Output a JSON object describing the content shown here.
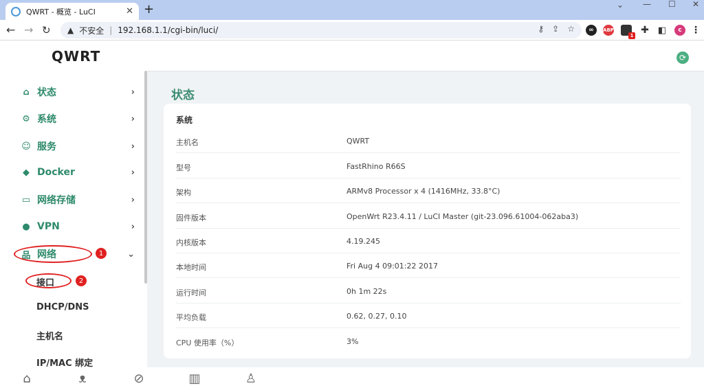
{
  "browser": {
    "tab_title": "QWRT - 概览 - LuCI",
    "tab_close": "✕",
    "new_tab": "+",
    "security_label": "不安全",
    "url": "192.168.1.1/cgi-bin/luci/",
    "ext_badge": "1",
    "profile_initial": "c"
  },
  "app": {
    "brand": "QWRT"
  },
  "sidebar": {
    "items": [
      {
        "label": "状态"
      },
      {
        "label": "系统"
      },
      {
        "label": "服务"
      },
      {
        "label": "Docker"
      },
      {
        "label": "网络存储"
      },
      {
        "label": "VPN"
      },
      {
        "label": "网络"
      }
    ],
    "subitems": [
      {
        "label": "接口"
      },
      {
        "label": "DHCP/DNS"
      },
      {
        "label": "主机名"
      },
      {
        "label": "IP/MAC 绑定"
      }
    ]
  },
  "annotations": {
    "badge1": "1",
    "badge2": "2"
  },
  "main": {
    "page_title": "状态",
    "section_title": "系统",
    "rows": [
      {
        "key": "主机名",
        "value": "QWRT"
      },
      {
        "key": "型号",
        "value": "FastRhino R66S"
      },
      {
        "key": "架构",
        "value": "ARMv8 Processor x 4 (1416MHz, 33.8°C)"
      },
      {
        "key": "固件版本",
        "value": "OpenWrt R23.4.11 / LuCI Master (git-23.096.61004-062aba3)"
      },
      {
        "key": "内核版本",
        "value": "4.19.245"
      },
      {
        "key": "本地时间",
        "value": "Fri Aug 4 09:01:22 2017"
      },
      {
        "key": "运行时间",
        "value": "0h 1m 22s"
      },
      {
        "key": "平均负载",
        "value": "0.62, 0.27, 0.10"
      },
      {
        "key": "CPU 使用率（%）",
        "value": "3%"
      }
    ]
  },
  "colors": {
    "accent": "#2e8a6c",
    "annotation": "#e02020"
  }
}
